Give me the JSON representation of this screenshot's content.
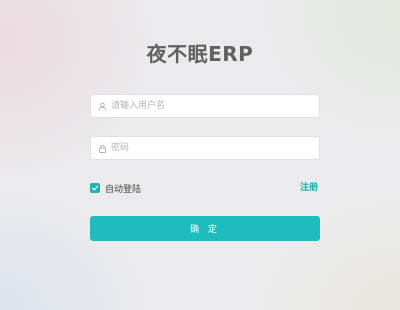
{
  "title": "夜不眠ERP",
  "username": {
    "placeholder": "请输入用户名",
    "value": "",
    "icon": "user-icon"
  },
  "password": {
    "placeholder": "密码",
    "value": "",
    "icon": "lock-icon"
  },
  "remember": {
    "label": "自动登陆",
    "checked": true
  },
  "register_link": "注册",
  "submit_label": "确 定",
  "colors": {
    "accent": "#1ebcbc",
    "title": "#616161",
    "background": "#ebebed"
  }
}
